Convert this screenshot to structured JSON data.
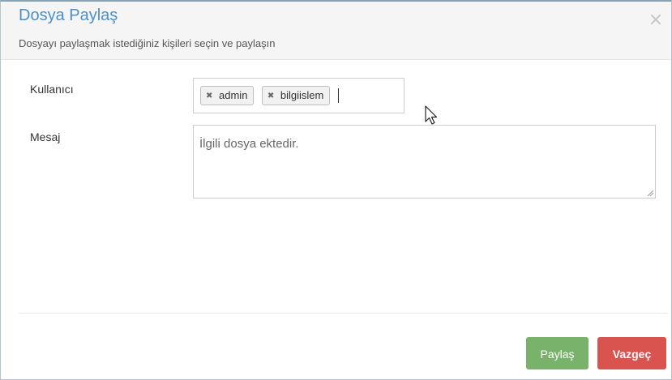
{
  "dialog": {
    "title": "Dosya Paylaş",
    "subtitle": "Dosyayı paylaşmak istediğiniz kişileri seçin ve paylaşın",
    "close_icon": "×"
  },
  "form": {
    "user_label": "Kullanıcı",
    "users": [
      "admin",
      "bilgiislem"
    ],
    "tag_remove_icon": "✖",
    "message_label": "Mesaj",
    "message_value": "İlgili dosya ektedir."
  },
  "buttons": {
    "share": "Paylaş",
    "cancel": "Vazgeç"
  },
  "colors": {
    "title": "#4a90c8",
    "share_button": "#79b26a",
    "cancel_button": "#d9534f"
  }
}
